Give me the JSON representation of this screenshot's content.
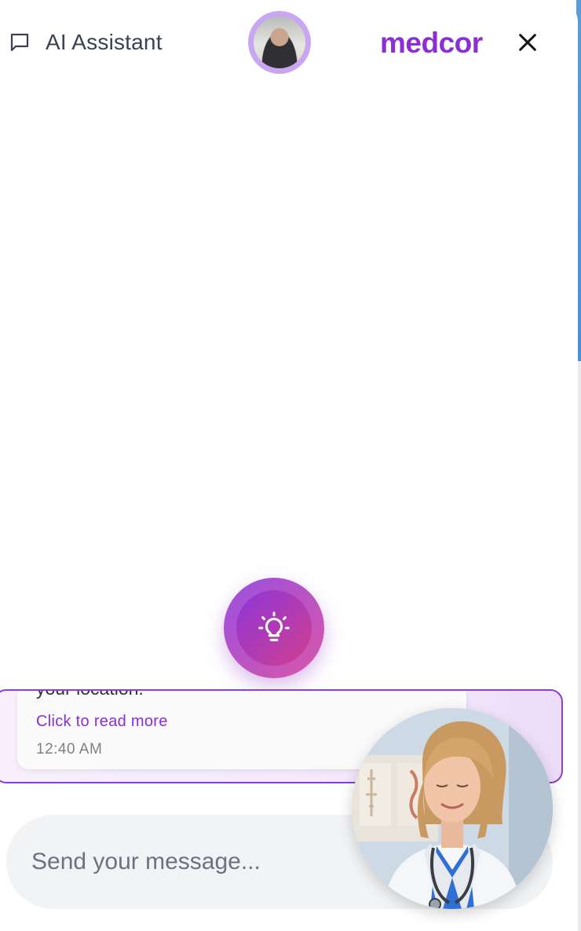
{
  "header": {
    "title": "AI Assistant",
    "brand": "medcor",
    "chat_icon": "chat-bubble-icon",
    "close_icon": "close-icon"
  },
  "assist_button": {
    "icon": "lightbulb-icon"
  },
  "message": {
    "text": "your location.",
    "read_more": "Click to read more",
    "time": "12:40 AM"
  },
  "composer": {
    "placeholder": "Send your message..."
  },
  "colors": {
    "brand": "#8a2fd6",
    "accent_gradient_start": "#9a4fe0",
    "accent_gradient_end": "#d957a8"
  }
}
